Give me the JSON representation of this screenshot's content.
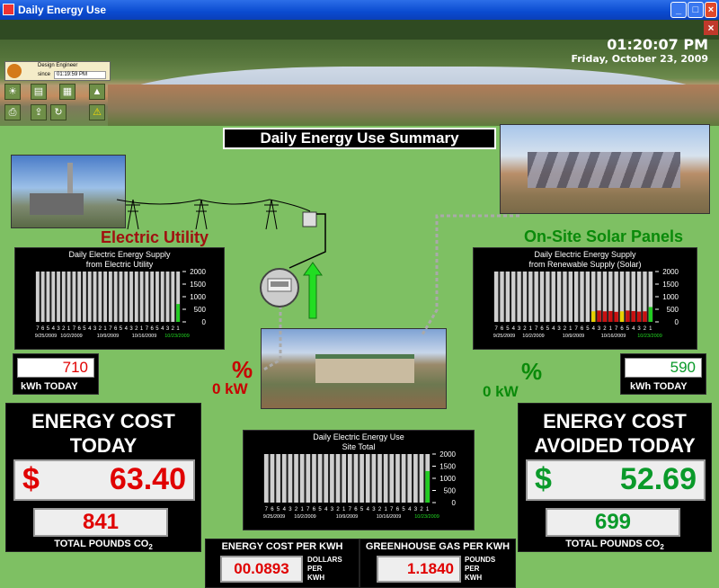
{
  "window": {
    "title": "Daily Energy Use"
  },
  "header": {
    "time": "01:20:07 PM",
    "date": "Friday, October 23, 2009"
  },
  "user": {
    "role": "Design Engineer",
    "since_label": "since",
    "since_time": "01:19:59 PM"
  },
  "summary_title": "Daily Energy Use Summary",
  "utility": {
    "label": "Electric Utility",
    "chart_title_1": "Daily Electric Energy Supply",
    "chart_title_2": "from Electric Utility",
    "kwh_value": "710",
    "kwh_label": "kWh TODAY",
    "pct": "%",
    "kw": "0 kW"
  },
  "solar": {
    "label": "On-Site Solar Panels",
    "chart_title_1": "Daily Electric Energy Supply",
    "chart_title_2": "from Renewable Supply (Solar)",
    "kwh_value": "590",
    "kwh_label": "kWh TODAY",
    "pct": "%",
    "kw": "0 kW"
  },
  "site": {
    "chart_title_1": "Daily Electric Energy Use",
    "chart_title_2": "Site Total"
  },
  "cost_today": {
    "head_1": "ENERGY COST",
    "head_2": "TODAY",
    "currency": "$",
    "value": "63.40",
    "pounds": "841",
    "pounds_label": "TOTAL POUNDS CO",
    "pounds_sub": "2"
  },
  "cost_avoided": {
    "head_1": "ENERGY COST",
    "head_2": "AVOIDED TODAY",
    "currency": "$",
    "value": "52.69",
    "pounds": "699",
    "pounds_label": "TOTAL POUNDS CO",
    "pounds_sub": "2"
  },
  "per_kwh": {
    "head": "ENERGY COST PER KWH",
    "value": "00.0893",
    "unit_1": "DOLLARS",
    "unit_2": "PER",
    "unit_3": "KWH"
  },
  "ghg_per_kwh": {
    "head": "GREENHOUSE GAS PER KWH",
    "value": "1.1840",
    "unit_1": "POUNDS",
    "unit_2": "PER",
    "unit_3": "KWH"
  },
  "colors": {
    "red": "#e00000",
    "green": "#0a9a2a",
    "bar_grey": "#cfcfcf",
    "bar_red": "#c81010",
    "bar_green": "#22cc22",
    "bar_yellow": "#e8d000"
  },
  "chart_data": [
    {
      "type": "bar",
      "title": "Daily Electric Energy Supply from Electric Utility",
      "ylim": [
        0,
        2000
      ],
      "yticks": [
        "2000",
        "1500",
        "1000",
        "500",
        "0"
      ],
      "day_ticks": [
        "7",
        "6",
        "5",
        "4",
        "3",
        "2",
        "1"
      ],
      "date_ticks": [
        "9/25/2009",
        "10/2/2009",
        "10/9/2009",
        "10/16/2009",
        "10/23/2009"
      ],
      "bar_count": 28,
      "series": [
        {
          "values": [
            0,
            0,
            0,
            0,
            0,
            0,
            0,
            0,
            0,
            0,
            0,
            0,
            0,
            0,
            0,
            0,
            0,
            0,
            0,
            0,
            0,
            0,
            0,
            0,
            0,
            0,
            0,
            710
          ]
        }
      ]
    },
    {
      "type": "bar",
      "title": "Daily Electric Energy Supply from Renewable Supply (Solar)",
      "ylim": [
        0,
        2000
      ],
      "yticks": [
        "2000",
        "1500",
        "1000",
        "500",
        "0"
      ],
      "day_ticks": [
        "7",
        "6",
        "5",
        "4",
        "3",
        "2",
        "1"
      ],
      "date_ticks": [
        "9/25/2009",
        "10/2/2009",
        "10/9/2009",
        "10/16/2009",
        "10/23/2009"
      ],
      "bar_count": 28,
      "series": [
        {
          "values": [
            0,
            0,
            0,
            0,
            0,
            0,
            0,
            0,
            0,
            0,
            0,
            0,
            0,
            0,
            0,
            0,
            0,
            420,
            450,
            420,
            430,
            400,
            420,
            450,
            430,
            410,
            420,
            590
          ]
        }
      ]
    },
    {
      "type": "bar",
      "title": "Daily Electric Energy Use Site Total",
      "ylim": [
        0,
        2000
      ],
      "yticks": [
        "2000",
        "1500",
        "1000",
        "500",
        "0"
      ],
      "day_ticks": [
        "7",
        "6",
        "5",
        "4",
        "3",
        "2",
        "1"
      ],
      "date_ticks": [
        "9/25/2009",
        "10/2/2009",
        "10/9/2009",
        "10/16/2009",
        "10/23/2009"
      ],
      "bar_count": 28,
      "series": [
        {
          "values": [
            0,
            0,
            0,
            0,
            0,
            0,
            0,
            0,
            0,
            0,
            0,
            0,
            0,
            0,
            0,
            0,
            0,
            0,
            0,
            0,
            0,
            0,
            0,
            0,
            0,
            0,
            0,
            1300
          ]
        }
      ]
    }
  ]
}
